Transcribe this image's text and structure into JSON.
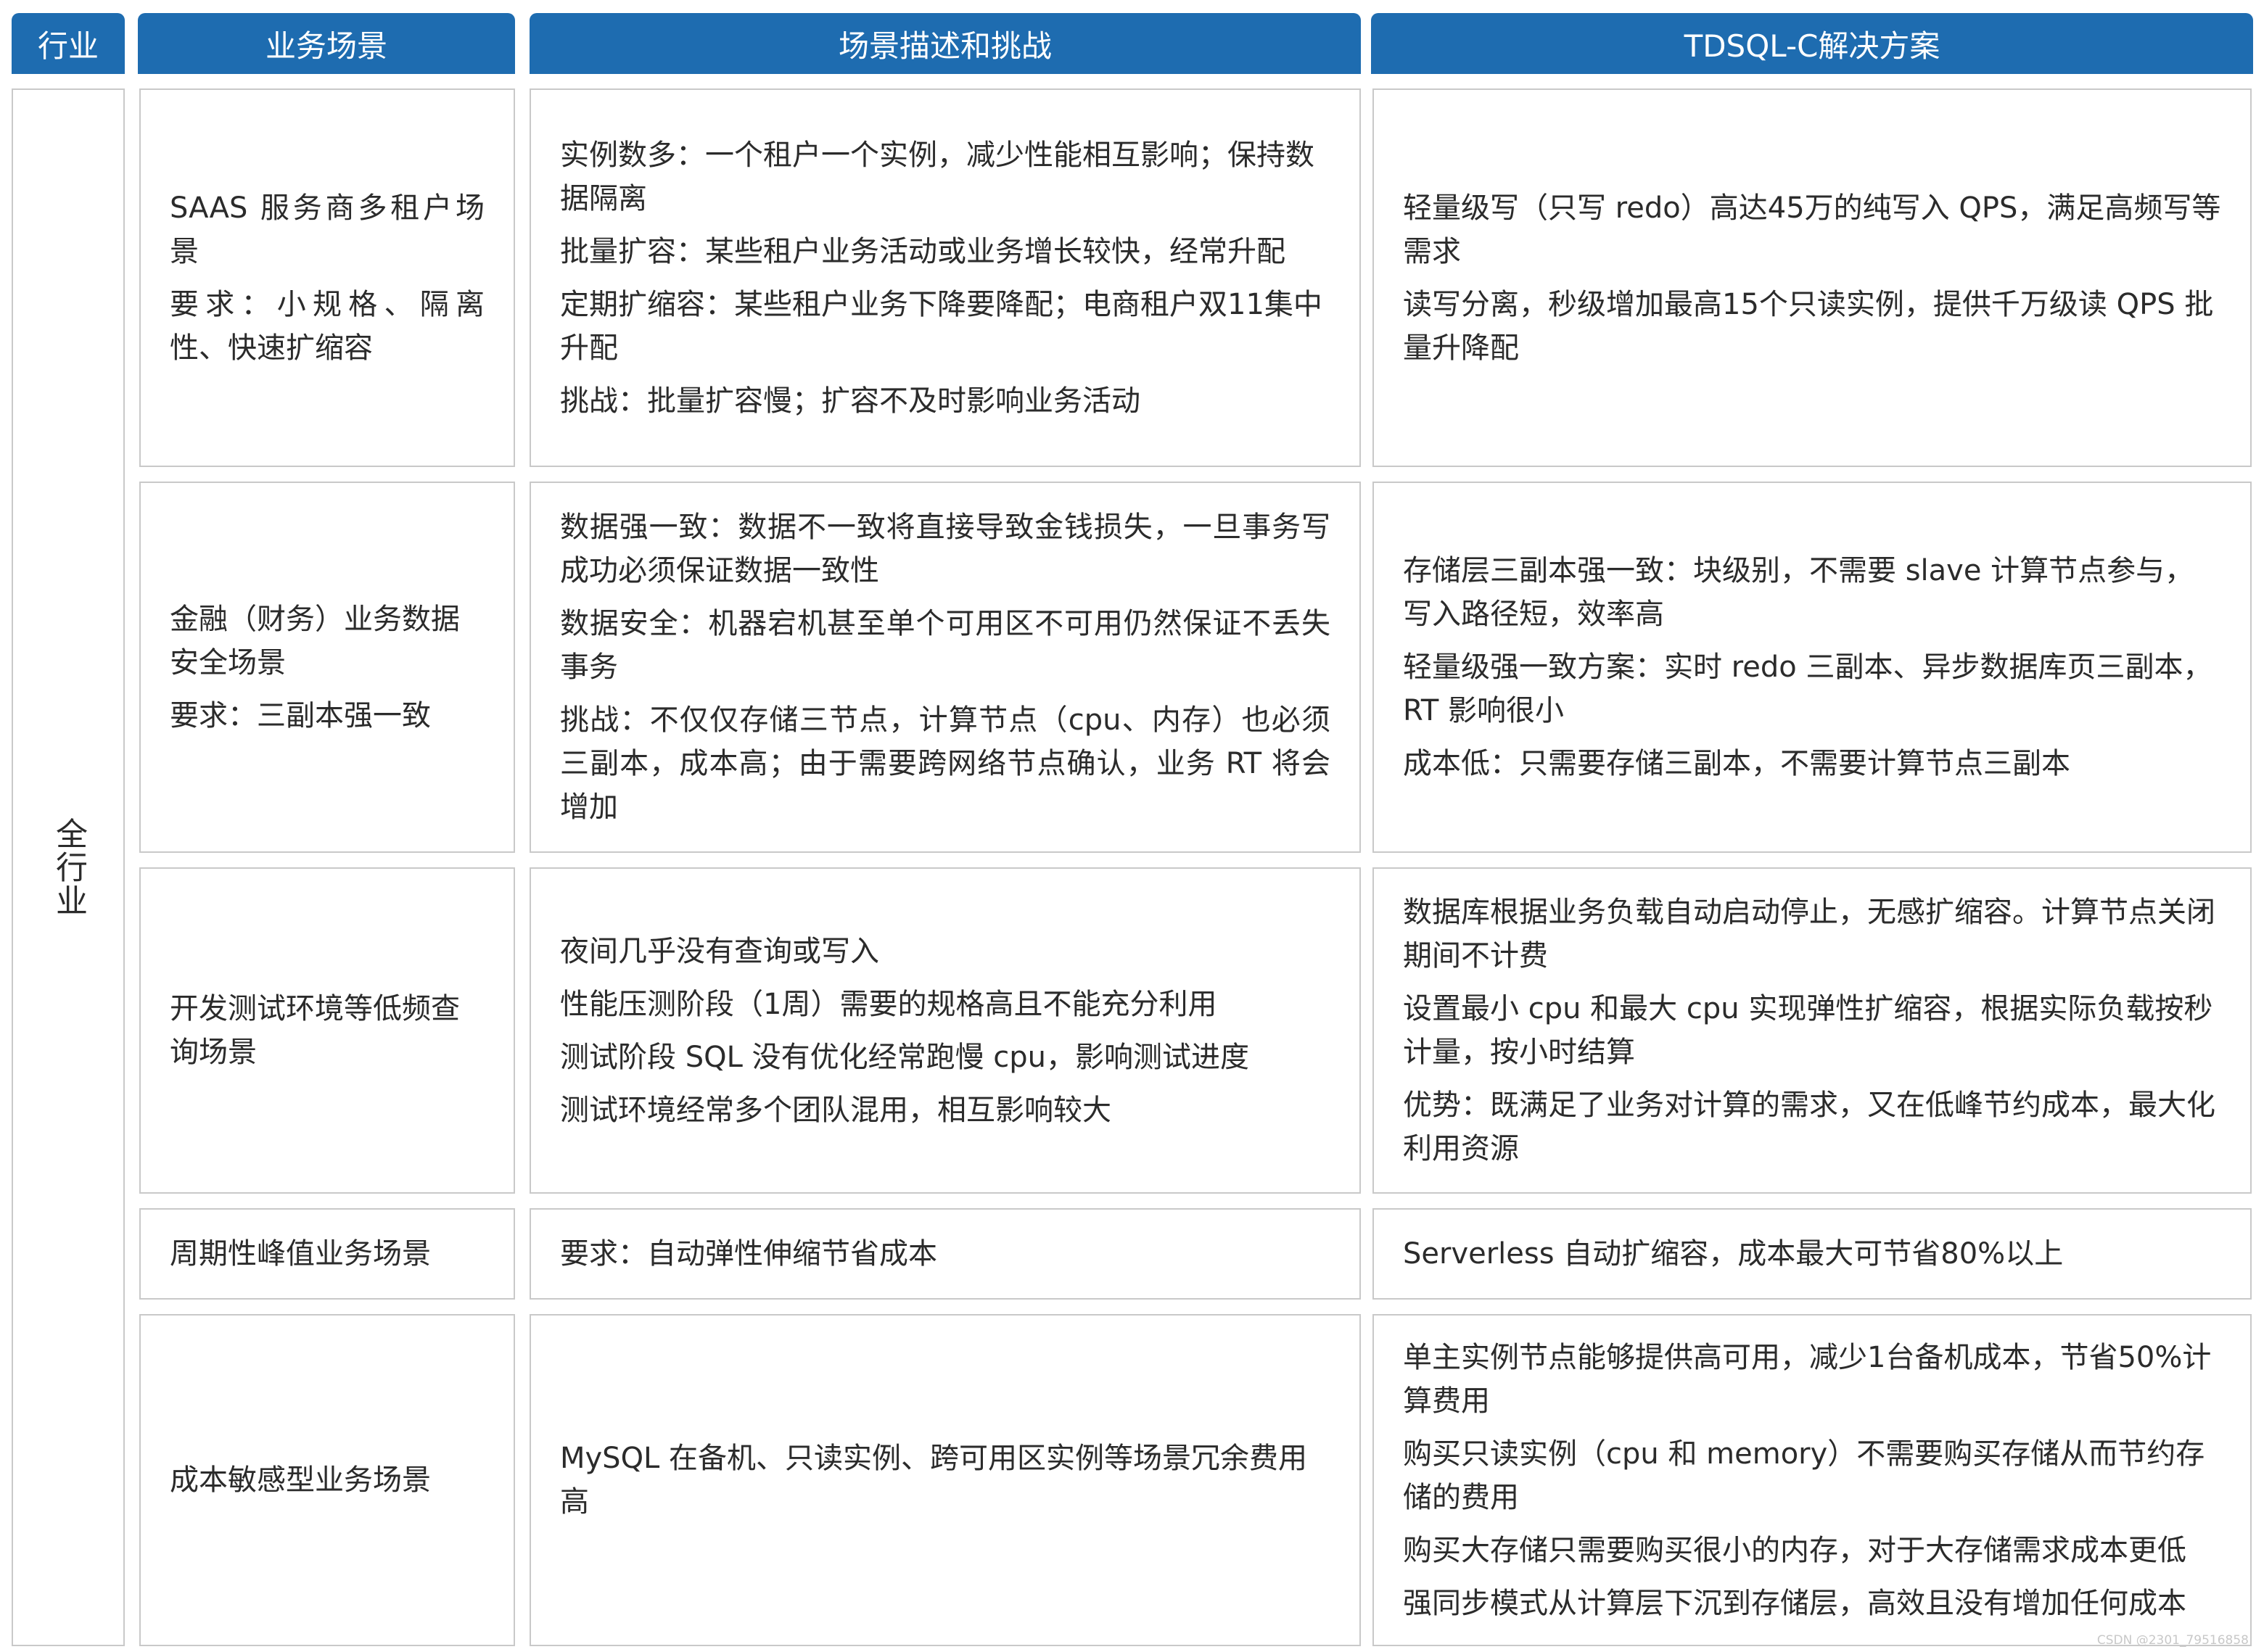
{
  "headers": {
    "industry": "行业",
    "scenario": "业务场景",
    "challenge": "场景描述和挑战",
    "solution": "TDSQL-C解决方案"
  },
  "industry_label": "全行业",
  "rows": [
    {
      "scenario": [
        "SAAS 服务商多租户场景",
        "要求：小规格、隔离性、快速扩缩容"
      ],
      "challenge": [
        "实例数多：一个租户一个实例，减少性能相互影响；保持数据隔离",
        "批量扩容：某些租户业务活动或业务增长较快，经常升配",
        "定期扩缩容：某些租户业务下降要降配；电商租户双11集中升配",
        "挑战：批量扩容慢；扩容不及时影响业务活动"
      ],
      "solution": [
        "轻量级写（只写 redo）高达45万的纯写入 QPS，满足高频写等需求",
        "读写分离，秒级增加最高15个只读实例，提供千万级读 QPS 批量升降配"
      ]
    },
    {
      "scenario": [
        "金融（财务）业务数据安全场景",
        "要求：三副本强一致"
      ],
      "challenge": [
        "数据强一致：数据不一致将直接导致金钱损失，一旦事务写成功必须保证数据一致性",
        "数据安全：机器宕机甚至单个可用区不可用仍然保证不丢失事务",
        "挑战：不仅仅存储三节点，计算节点（cpu、内存）也必须三副本，成本高；由于需要跨网络节点确认，业务 RT 将会增加"
      ],
      "solution": [
        "存储层三副本强一致：块级别，不需要 slave 计算节点参与，写入路径短，效率高",
        "轻量级强一致方案：实时 redo 三副本、异步数据库页三副本，RT 影响很小",
        "成本低：只需要存储三副本，不需要计算节点三副本"
      ]
    },
    {
      "scenario": [
        "开发测试环境等低频查询场景"
      ],
      "challenge": [
        "夜间几乎没有查询或写入",
        "性能压测阶段（1周）需要的规格高且不能充分利用",
        "测试阶段 SQL 没有优化经常跑慢 cpu，影响测试进度",
        "测试环境经常多个团队混用，相互影响较大"
      ],
      "solution": [
        "数据库根据业务负载自动启动停止，无感扩缩容。计算节点关闭期间不计费",
        "设置最小 cpu 和最大 cpu 实现弹性扩缩容，根据实际负载按秒计量，按小时结算",
        "优势：既满足了业务对计算的需求，又在低峰节约成本，最大化利用资源"
      ]
    },
    {
      "scenario": [
        "周期性峰值业务场景"
      ],
      "challenge": [
        "要求：自动弹性伸缩节省成本"
      ],
      "solution": [
        "Serverless 自动扩缩容，成本最大可节省80%以上"
      ]
    },
    {
      "scenario": [
        "成本敏感型业务场景"
      ],
      "challenge": [
        "MySQL 在备机、只读实例、跨可用区实例等场景冗余费用高"
      ],
      "solution": [
        "单主实例节点能够提供高可用，减少1台备机成本，节省50%计算费用",
        "购买只读实例（cpu 和 memory）不需要购买存储从而节约存储的费用",
        "购买大存储只需要购买很小的内存，对于大存储需求成本更低",
        "强同步模式从计算层下沉到存储层，高效且没有增加任何成本"
      ]
    }
  ],
  "watermark": "CSDN @2301_79516858"
}
